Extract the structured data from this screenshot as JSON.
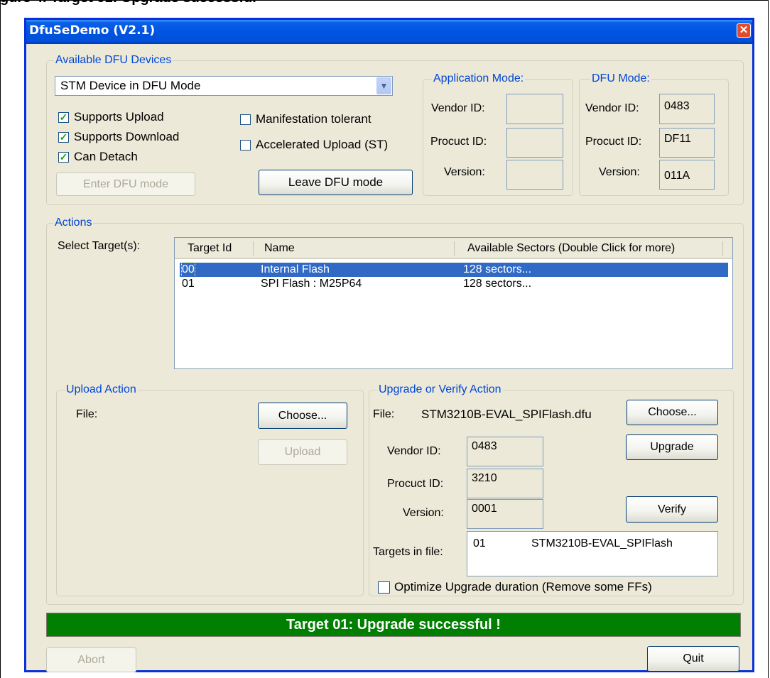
{
  "doc_caption": "gure 4.    Target 01: Upgrade successful",
  "window": {
    "title": "DfuSeDemo (V2.1)",
    "close_glyph": "✕"
  },
  "devices": {
    "group_label": "Available DFU Devices",
    "selected_device": "STM Device in DFU Mode",
    "checkboxes": [
      {
        "label": "Supports Upload",
        "checked": true
      },
      {
        "label": "Supports Download",
        "checked": true
      },
      {
        "label": "Can Detach",
        "checked": true
      },
      {
        "label": "Manifestation tolerant",
        "checked": false
      },
      {
        "label": "Accelerated Upload (ST)",
        "checked": false
      }
    ],
    "enter_dfu_label": "Enter DFU mode",
    "leave_dfu_label": "Leave DFU mode"
  },
  "app_mode": {
    "group_label": "Application Mode:",
    "vendor_label": "Vendor ID:",
    "vendor_value": "",
    "product_label": "Procuct ID:",
    "product_value": "",
    "version_label": "Version:",
    "version_value": ""
  },
  "dfu_mode": {
    "group_label": "DFU Mode:",
    "vendor_label": "Vendor ID:",
    "vendor_value": "0483",
    "product_label": "Procuct ID:",
    "product_value": "DF11",
    "version_label": "Version:",
    "version_value": "011A"
  },
  "actions": {
    "group_label": "Actions",
    "select_targets_label": "Select Target(s):",
    "columns": [
      "Target Id",
      "Name",
      "Available Sectors (Double Click for more)"
    ],
    "rows": [
      {
        "id": "00",
        "name": "Internal Flash",
        "sectors": "128 sectors...",
        "selected": true
      },
      {
        "id": "01",
        "name": "SPI Flash : M25P64",
        "sectors": "128 sectors...",
        "selected": false
      }
    ]
  },
  "upload": {
    "group_label": "Upload Action",
    "file_label": "File:",
    "choose_label": "Choose...",
    "upload_label": "Upload"
  },
  "upgrade": {
    "group_label": "Upgrade or Verify Action",
    "file_label": "File:",
    "file_name": "STM3210B-EVAL_SPIFlash.dfu",
    "choose_label": "Choose...",
    "vendor_label": "Vendor ID:",
    "vendor_value": "0483",
    "product_label": "Procuct ID:",
    "product_value": "3210",
    "version_label": "Version:",
    "version_value": "0001",
    "upgrade_label": "Upgrade",
    "verify_label": "Verify",
    "targets_label": "Targets in file:",
    "targets": [
      {
        "id": "01",
        "name": "STM3210B-EVAL_SPIFlash"
      }
    ],
    "optimize_label": "Optimize Upgrade duration (Remove some FFs)",
    "optimize_checked": false
  },
  "status": {
    "text": "Target 01: Upgrade successful !",
    "color": "#007f00"
  },
  "bottom": {
    "abort_label": "Abort",
    "quit_label": "Quit"
  },
  "colors": {
    "group_label": "#0046d5",
    "selection": "#316ac5",
    "titlebar": "#0054e3"
  }
}
